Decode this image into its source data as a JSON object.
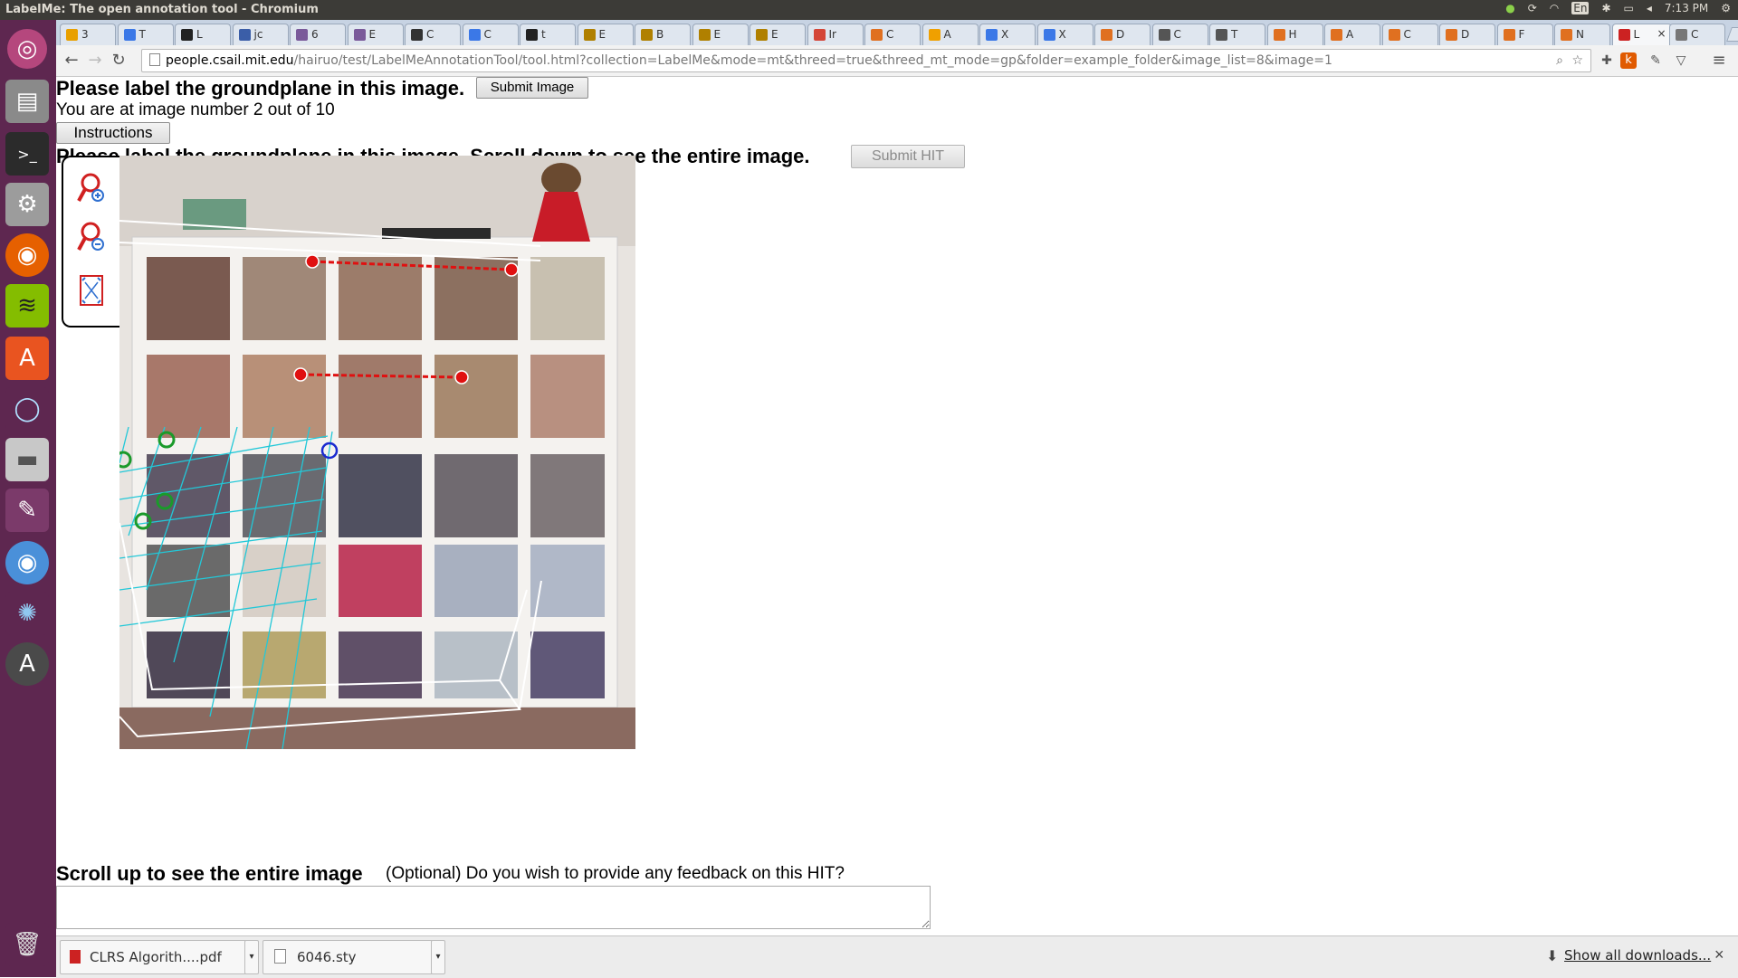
{
  "window_title": "LabelMe: The open annotation tool - Chromium",
  "system_tray": {
    "keyboard": "En",
    "time": "7:13 PM"
  },
  "tabs": [
    {
      "label": "3",
      "color": "#e8a000"
    },
    {
      "label": "T",
      "color": "#3b78e7"
    },
    {
      "label": "L",
      "color": "#222222"
    },
    {
      "label": "jc",
      "color": "#3b5ea8"
    },
    {
      "label": "6",
      "color": "#7a5a9a"
    },
    {
      "label": "E",
      "color": "#7a5a9a"
    },
    {
      "label": "C",
      "color": "#333333"
    },
    {
      "label": "C",
      "color": "#3b78e7"
    },
    {
      "label": "t",
      "color": "#222222"
    },
    {
      "label": "E",
      "color": "#b08000"
    },
    {
      "label": "B",
      "color": "#b08000"
    },
    {
      "label": "E",
      "color": "#b08000"
    },
    {
      "label": "E",
      "color": "#b08000"
    },
    {
      "label": "Ir",
      "color": "#d44638"
    },
    {
      "label": "C",
      "color": "#e07020"
    },
    {
      "label": "A",
      "color": "#f0a000"
    },
    {
      "label": "X",
      "color": "#3b78e7"
    },
    {
      "label": "X",
      "color": "#3b78e7"
    },
    {
      "label": "D",
      "color": "#e07020"
    },
    {
      "label": "C",
      "color": "#555555"
    },
    {
      "label": "T",
      "color": "#555555"
    },
    {
      "label": "H",
      "color": "#e07020"
    },
    {
      "label": "A",
      "color": "#e07020"
    },
    {
      "label": "C",
      "color": "#e07020"
    },
    {
      "label": "D",
      "color": "#e07020"
    },
    {
      "label": "F",
      "color": "#e07020"
    },
    {
      "label": "N",
      "color": "#e07020"
    },
    {
      "label": "L",
      "color": "#cc2222",
      "active": true
    },
    {
      "label": "C",
      "color": "#777777"
    }
  ],
  "address": {
    "host": "people.csail.mit.edu",
    "path": "/hairuo/test/LabelMeAnnotationTool/tool.html?collection=LabelMe&mode=mt&threed=true&threed_mt_mode=gp&folder=example_folder&image_list=8&image=1"
  },
  "page": {
    "heading": "Please label the groundplane in this image.",
    "submit_image": "Submit Image",
    "progress": "You are at image number 2 out of 10",
    "instructions": "Instructions",
    "heading2": "Please label the groundplane in this image. Scroll down to see the entire image.",
    "submit_hit": "Submit HIT",
    "scroll_up": "Scroll up to see the entire image",
    "feedback_prompt": "(Optional) Do you wish to provide any feedback on this HIT?",
    "feedback_value": ""
  },
  "downloads": {
    "items": [
      "CLRS Algorith....pdf",
      "6046.sty"
    ],
    "show_all": "Show all downloads...",
    "close": "×"
  },
  "colors": {
    "launcher": "#5e2750",
    "panel": "#3c3b37",
    "annotation_red": "#e01010",
    "annotation_green": "#1a9a2a",
    "annotation_blue": "#1a2ad0",
    "grid": "#22c8d8"
  }
}
